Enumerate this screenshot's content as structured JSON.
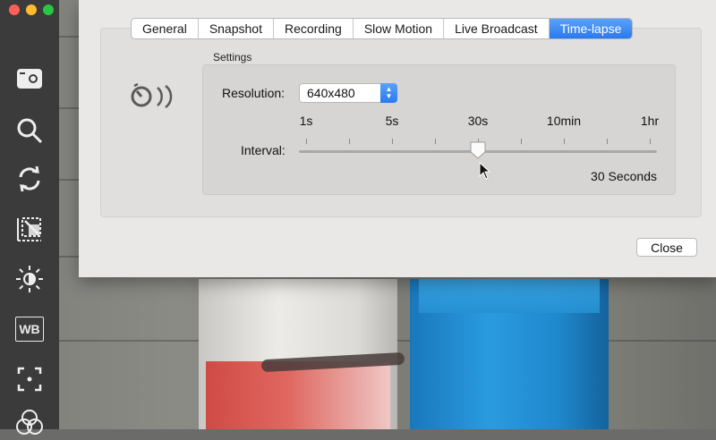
{
  "window": {
    "traffic_lights": [
      {
        "name": "close",
        "color": "#fe5f57"
      },
      {
        "name": "minimize",
        "color": "#febc2e"
      },
      {
        "name": "zoom",
        "color": "#28c840"
      }
    ]
  },
  "toolbar": {
    "tools": [
      {
        "id": "camera-source",
        "icon": "drive-icon"
      },
      {
        "id": "zoom",
        "icon": "magnifier-icon"
      },
      {
        "id": "rotate",
        "icon": "rotate-arrows-icon"
      },
      {
        "id": "crop",
        "icon": "crop-icon"
      },
      {
        "id": "exposure",
        "icon": "brightness-icon"
      },
      {
        "id": "white-balance",
        "icon": "wb-icon",
        "label": "WB"
      },
      {
        "id": "focus",
        "icon": "focus-icon"
      },
      {
        "id": "color",
        "icon": "color-circles-icon"
      }
    ]
  },
  "prefs": {
    "tabs": [
      {
        "label": "General",
        "active": false
      },
      {
        "label": "Snapshot",
        "active": false
      },
      {
        "label": "Recording",
        "active": false
      },
      {
        "label": "Slow Motion",
        "active": false
      },
      {
        "label": "Live Broadcast",
        "active": false
      },
      {
        "label": "Time-lapse",
        "active": true
      }
    ],
    "section_icon": "timelapse-icon",
    "settings_title": "Settings",
    "resolution": {
      "label": "Resolution:",
      "value": "640x480"
    },
    "interval": {
      "label": "Interval:",
      "tick_labels": [
        "1s",
        "5s",
        "30s",
        "10min",
        "1hr"
      ],
      "tick_count": 9,
      "selected_index": 4,
      "value_text": "30 Seconds"
    },
    "close_label": "Close"
  },
  "colors": {
    "accent": "#2f80ed",
    "toolbar": "#3b3b3c",
    "window": "#e9e8e7"
  }
}
